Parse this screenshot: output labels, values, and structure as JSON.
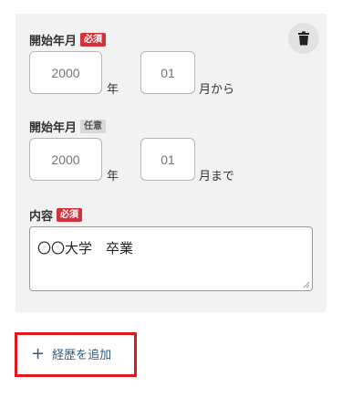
{
  "form": {
    "period_start": {
      "label": "開始年月",
      "badge": "必須",
      "year_placeholder": "2000",
      "year_suffix": "年",
      "month_placeholder": "01",
      "month_suffix": "月から"
    },
    "period_end": {
      "label": "開始年月",
      "badge": "任意",
      "year_placeholder": "2000",
      "year_suffix": "年",
      "month_placeholder": "01",
      "month_suffix": "月まで"
    },
    "content": {
      "label": "内容",
      "badge": "必須",
      "value": "〇〇大学　卒業"
    },
    "delete_icon": "trash-icon"
  },
  "actions": {
    "add_history_label": "経歴を追加",
    "add_icon": "plus-icon"
  },
  "colors": {
    "required_badge": "#d0343b",
    "optional_badge": "#d9d9d9",
    "link": "#2f5d86",
    "highlight_frame": "#e0181d"
  }
}
